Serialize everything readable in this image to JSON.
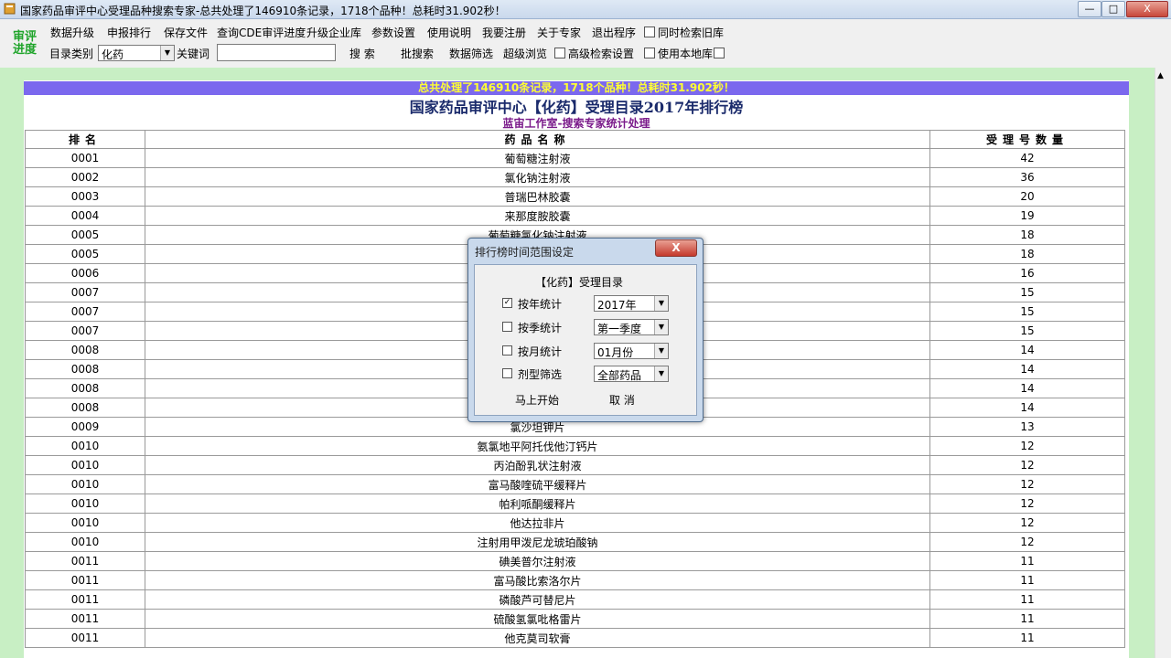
{
  "window": {
    "title": "国家药品审评中心受理品种搜索专家-总共处理了146910条记录，1718个品种！总耗时31.902秒！",
    "min_label": "—",
    "max_label": "□",
    "close_label": "X"
  },
  "logo": {
    "line1": "审评",
    "line2": "进度"
  },
  "menu": [
    "数据升级",
    "申报排行",
    "保存文件",
    "查询CDE审评进度",
    "升级企业库",
    "参数设置",
    "使用说明",
    "我要注册",
    "关于专家",
    "退出程序"
  ],
  "toolbar": {
    "sync_label": "同时检索旧库",
    "category_label": "目录类别",
    "category_value": "化药",
    "keyword_label": "关键词",
    "keyword_value": "",
    "search_label": "搜  索",
    "batch_label": "批搜索",
    "filter_label": "数据筛选",
    "super_label": "超级浏览",
    "advanced_label": "高级检索设置",
    "local_label": "使用本地库"
  },
  "report": {
    "banner": "总共处理了146910条记录，1718个品种！总耗时31.902秒！",
    "title": "国家药品审评中心【化药】受理目录2017年排行榜",
    "subtitle": "蓝宙工作室-搜索专家统计处理",
    "headers": [
      "排名",
      "药品名称",
      "受理号数量"
    ],
    "rows": [
      [
        "0001",
        "葡萄糖注射液",
        "42"
      ],
      [
        "0002",
        "氯化钠注射液",
        "36"
      ],
      [
        "0003",
        "普瑞巴林胶囊",
        "20"
      ],
      [
        "0004",
        "来那度胺胶囊",
        "19"
      ],
      [
        "0005",
        "葡萄糖氯化钠注射液",
        "18"
      ],
      [
        "0005",
        "",
        "18"
      ],
      [
        "0006",
        "",
        "16"
      ],
      [
        "0007",
        "",
        "15"
      ],
      [
        "0007",
        "",
        "15"
      ],
      [
        "0007",
        "",
        "15"
      ],
      [
        "0008",
        "",
        "14"
      ],
      [
        "0008",
        "",
        "14"
      ],
      [
        "0008",
        "",
        "14"
      ],
      [
        "0008",
        "",
        "14"
      ],
      [
        "0009",
        "氯沙坦钾片",
        "13"
      ],
      [
        "0010",
        "氨氯地平阿托伐他汀钙片",
        "12"
      ],
      [
        "0010",
        "丙泊酚乳状注射液",
        "12"
      ],
      [
        "0010",
        "富马酸喹硫平缓释片",
        "12"
      ],
      [
        "0010",
        "帕利哌酮缓释片",
        "12"
      ],
      [
        "0010",
        "他达拉非片",
        "12"
      ],
      [
        "0010",
        "注射用甲泼尼龙琥珀酸钠",
        "12"
      ],
      [
        "0011",
        "碘美普尔注射液",
        "11"
      ],
      [
        "0011",
        "富马酸比索洛尔片",
        "11"
      ],
      [
        "0011",
        "磷酸芦可替尼片",
        "11"
      ],
      [
        "0011",
        "硫酸氢氯吡格雷片",
        "11"
      ],
      [
        "0011",
        "他克莫司软膏",
        "11"
      ]
    ]
  },
  "dialog": {
    "title": "排行榜时间范围设定",
    "close_label": "X",
    "heading": "【化药】受理目录",
    "options": [
      {
        "label": "按年统计",
        "checked": true,
        "value": "2017年"
      },
      {
        "label": "按季统计",
        "checked": false,
        "value": "第一季度"
      },
      {
        "label": "按月统计",
        "checked": false,
        "value": "01月份"
      },
      {
        "label": "剂型筛选",
        "checked": false,
        "value": "全部药品"
      }
    ],
    "start_label": "马上开始",
    "cancel_label": "取  消"
  }
}
